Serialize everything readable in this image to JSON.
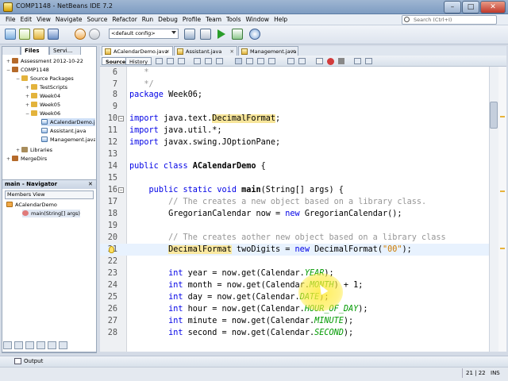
{
  "window": {
    "title": "COMP1148 - NetBeans IDE 7.2",
    "min_glyph": "–",
    "max_glyph": "□",
    "close_glyph": "✕"
  },
  "menu": [
    "File",
    "Edit",
    "View",
    "Navigate",
    "Source",
    "Refactor",
    "Run",
    "Debug",
    "Profile",
    "Team",
    "Tools",
    "Window",
    "Help"
  ],
  "search": {
    "placeholder": "Search (Ctrl+I)"
  },
  "toolbar": {
    "config": "<default config>"
  },
  "left_panel": {
    "tabs": [
      "Files",
      "Servi..."
    ],
    "tree": [
      {
        "label": "Assessment 2012-10-22",
        "depth": 0,
        "twisty": "+"
      },
      {
        "label": "COMP1148",
        "depth": 0,
        "twisty": "−"
      },
      {
        "label": "Source Packages",
        "depth": 1,
        "twisty": "−"
      },
      {
        "label": "TestScripts",
        "depth": 2,
        "twisty": "+"
      },
      {
        "label": "Week04",
        "depth": 2,
        "twisty": "+"
      },
      {
        "label": "Week05",
        "depth": 2,
        "twisty": "+"
      },
      {
        "label": "Week06",
        "depth": 2,
        "twisty": "−"
      },
      {
        "label": "ACalendarDemo.java",
        "depth": 3,
        "twisty": ""
      },
      {
        "label": "Assistant.java",
        "depth": 3,
        "twisty": ""
      },
      {
        "label": "Management.java",
        "depth": 3,
        "twisty": ""
      },
      {
        "label": "Libraries",
        "depth": 1,
        "twisty": "+"
      },
      {
        "label": "MergeDirs",
        "depth": 0,
        "twisty": "+"
      }
    ]
  },
  "navigator": {
    "title": "main - Navigator",
    "close_glyph": "✕",
    "view": "Members View",
    "items": [
      {
        "label": "ACalendarDemo",
        "depth": 0
      },
      {
        "label": "main(String[] args)",
        "depth": 1
      }
    ]
  },
  "editor": {
    "tabs": [
      {
        "label": "ACalendarDemo.java",
        "active": true
      },
      {
        "label": "Assistant.java",
        "active": false
      },
      {
        "label": "Management.java",
        "active": false
      }
    ],
    "tab_close_glyph": "✕",
    "views": [
      "Source",
      "History"
    ],
    "lines": [
      {
        "n": "6",
        "text": "   *"
      },
      {
        "n": "7",
        "text": "   */"
      },
      {
        "n": "8",
        "text": "package Week06;"
      },
      {
        "n": "9",
        "text": ""
      },
      {
        "n": "10",
        "text": "import java.text.DecimalFormat;"
      },
      {
        "n": "11",
        "text": "import java.util.*;"
      },
      {
        "n": "12",
        "text": "import javax.swing.JOptionPane;"
      },
      {
        "n": "13",
        "text": ""
      },
      {
        "n": "14",
        "text": "public class ACalendarDemo {"
      },
      {
        "n": "15",
        "text": ""
      },
      {
        "n": "16",
        "text": "    public static void main(String[] args) {"
      },
      {
        "n": "17",
        "text": "        // The creates a new object based on a library class."
      },
      {
        "n": "18",
        "text": "        GregorianCalendar now = new GregorianCalendar();"
      },
      {
        "n": "19",
        "text": ""
      },
      {
        "n": "20",
        "text": "        // The creates aother new object based on a library class"
      },
      {
        "n": "21",
        "text": "        DecimalFormat twoDigits = new DecimalFormat(\"00\");"
      },
      {
        "n": "22",
        "text": ""
      },
      {
        "n": "23",
        "text": "        int year = now.get(Calendar.YEAR);"
      },
      {
        "n": "24",
        "text": "        int month = now.get(Calendar.MONTH) + 1;"
      },
      {
        "n": "25",
        "text": "        int day = now.get(Calendar.DATE);"
      },
      {
        "n": "26",
        "text": "        int hour = now.get(Calendar.HOUR_OF_DAY);"
      },
      {
        "n": "27",
        "text": "        int minute = now.get(Calendar.MINUTE);"
      },
      {
        "n": "28",
        "text": "        int second = now.get(Calendar.SECOND);"
      }
    ]
  },
  "output": {
    "label": "Output"
  },
  "status": {
    "position": "21 | 22",
    "mode": "INS"
  }
}
